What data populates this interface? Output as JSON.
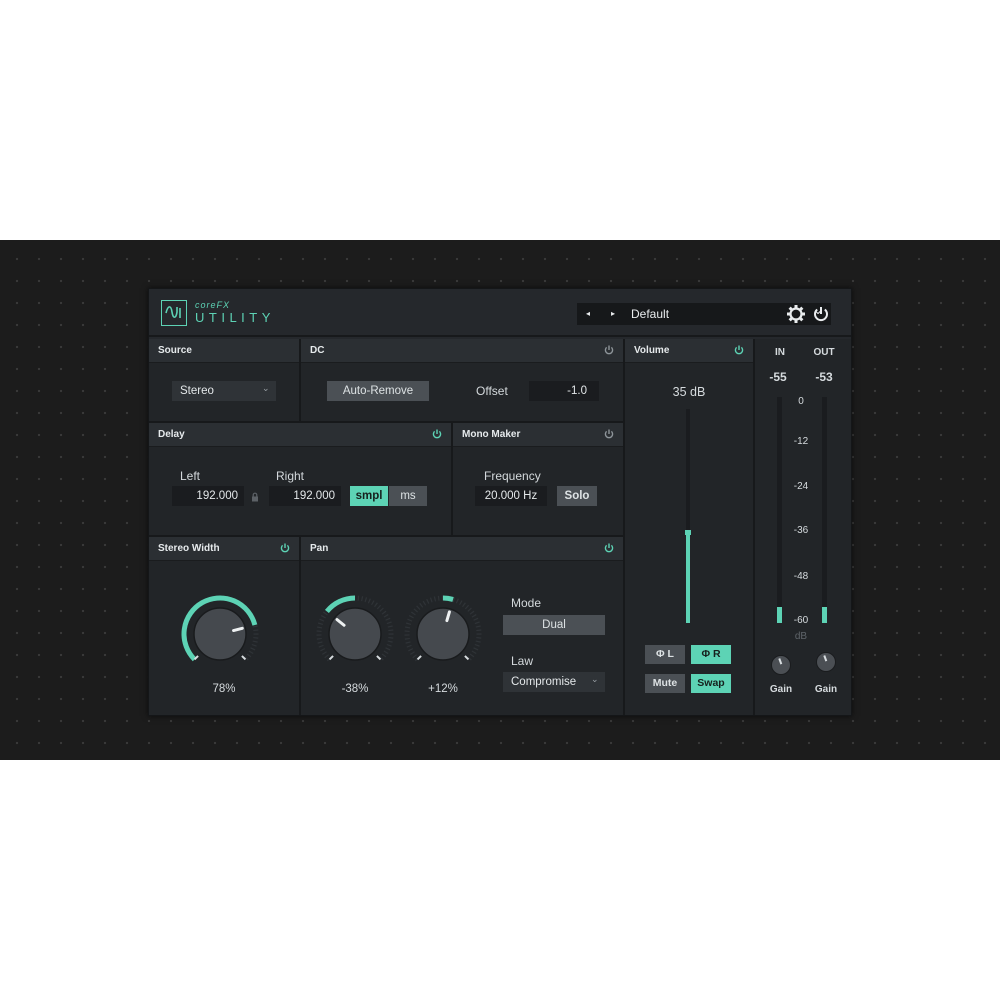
{
  "colors": {
    "accent": "#5dd3b5",
    "background": "#1c1c1c",
    "panel": "#25282c",
    "field": "#1a1c1f"
  },
  "header": {
    "brand_small": "coreFX",
    "brand_big": "UTILITY",
    "logo_icon": "sine-wave-icon",
    "prev_icon": "◂",
    "next_icon": "▸",
    "preset": "Default",
    "preset_chevron": "⌄",
    "settings_icon": "gear-icon",
    "power_icon": "power-icon"
  },
  "source": {
    "title": "Source",
    "value": "Stereo",
    "chevron": "⌄"
  },
  "dc": {
    "title": "DC",
    "auto_remove": "Auto-Remove",
    "offset_label": "Offset",
    "offset_value": "-1.0"
  },
  "delay": {
    "title": "Delay",
    "left_label": "Left",
    "left_value": "192.000",
    "right_label": "Right",
    "right_value": "192.000",
    "unit_smpl": "smpl",
    "unit_ms": "ms",
    "lock_icon": "lock-icon"
  },
  "mono_maker": {
    "title": "Mono Maker",
    "frequency_label": "Frequency",
    "frequency_value": "20.000 Hz",
    "solo": "Solo"
  },
  "stereo_width": {
    "title": "Stereo Width",
    "value_text": "78%",
    "value": 0.78
  },
  "pan": {
    "title": "Pan",
    "left_text": "-38%",
    "left_value": -0.38,
    "right_text": "+12%",
    "right_value": 0.12,
    "mode_label": "Mode",
    "mode_value": "Dual",
    "law_label": "Law",
    "law_value": "Compromise",
    "law_chevron": "⌄"
  },
  "volume": {
    "title": "Volume",
    "value_text": "35 dB",
    "level": 0.42,
    "phase_l": "Φ L",
    "phase_r": "Φ R",
    "mute": "Mute",
    "swap": "Swap"
  },
  "meters": {
    "in_label": "IN",
    "out_label": "OUT",
    "in_value": "-55",
    "out_value": "-53",
    "scale": [
      "0",
      "-12",
      "-24",
      "-36",
      "-48",
      "-60"
    ],
    "unit": "dB",
    "in_level": 0.07,
    "out_level": 0.07,
    "in_gain": "Gain",
    "out_gain": "Gain"
  }
}
